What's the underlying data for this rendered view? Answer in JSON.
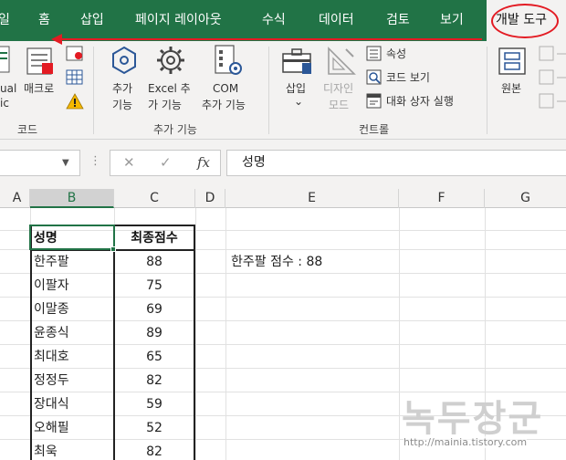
{
  "menu": {
    "items": [
      "일",
      "홈",
      "삽입",
      "페이지 레이아웃",
      "수식",
      "데이터",
      "검토",
      "보기",
      "개발 도구"
    ],
    "active_index": 8
  },
  "ribbon": {
    "code_group": {
      "visual_basic_label_1": "ual",
      "visual_basic_label_2": "ic",
      "macro_label": "매크로",
      "group_label": "코드"
    },
    "addins_group": {
      "addins_label_1": "추가",
      "addins_label_2": "기능",
      "excel_addins_label_1": "Excel 추",
      "excel_addins_label_2": "가 기능",
      "com_addins_label_1": "COM",
      "com_addins_label_2": "추가 기능",
      "group_label": "추가 기능"
    },
    "controls_group": {
      "insert_label": "삽입",
      "insert_arrow": "⌄",
      "design_mode_label_1": "디자인",
      "design_mode_label_2": "모드",
      "properties_label": "속성",
      "view_code_label": "코드 보기",
      "run_dialog_label": "대화 상자 실행",
      "group_label": "컨트롤"
    },
    "xml_group": {
      "source_label": "원본"
    }
  },
  "formula_bar": {
    "name_box_value": "",
    "cancel_symbol": "✕",
    "enter_symbol": "✓",
    "fx_symbol": "fx",
    "content": "성명"
  },
  "grid": {
    "columns": [
      "A",
      "B",
      "C",
      "D",
      "E",
      "F",
      "G"
    ],
    "selected_column": "B",
    "table": {
      "headers": [
        "성명",
        "최종점수"
      ],
      "rows": [
        {
          "name": "한주팔",
          "score": "88"
        },
        {
          "name": "이팔자",
          "score": "75"
        },
        {
          "name": "이말종",
          "score": "69"
        },
        {
          "name": "윤종식",
          "score": "89"
        },
        {
          "name": "최대호",
          "score": "65"
        },
        {
          "name": "정정두",
          "score": "82"
        },
        {
          "name": "장대식",
          "score": "59"
        },
        {
          "name": "오해필",
          "score": "52"
        },
        {
          "name": "최욱",
          "score": "82"
        }
      ]
    },
    "note": "한주팔 점수 : 88"
  },
  "watermark": {
    "title": "녹두장군",
    "url": "http://mainia.tistory.com"
  },
  "colors": {
    "excel_green": "#217346",
    "annotation_red": "#e31b23"
  }
}
